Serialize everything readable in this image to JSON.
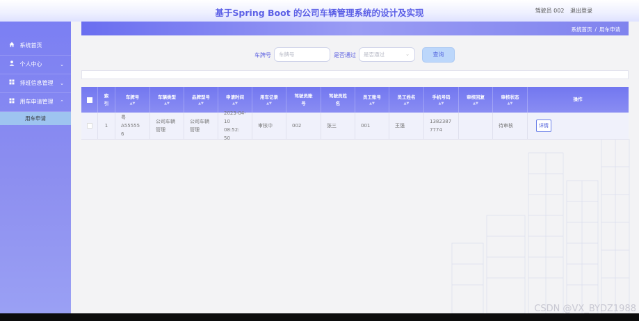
{
  "header": {
    "title": "基于Spring Boot 的公司车辆管理系统的设计及实现",
    "user": "驾驶员 002",
    "logout": "退出登录"
  },
  "sidebar": {
    "items": [
      {
        "label": "系统首页",
        "icon": "home-icon",
        "has_chevron": false
      },
      {
        "label": "个人中心",
        "icon": "user-icon",
        "has_chevron": true
      },
      {
        "label": "排班信息管理",
        "icon": "grid-icon",
        "has_chevron": true
      },
      {
        "label": "用车申请管理",
        "icon": "grid-icon",
        "has_chevron": true,
        "expanded": true
      }
    ],
    "sub_items": [
      {
        "label": "用车申请",
        "active": true
      }
    ]
  },
  "breadcrumb": {
    "home": "系统首页",
    "separator": "/",
    "current": "用车申请"
  },
  "search": {
    "plate_label": "车牌号",
    "plate_placeholder": "车牌号",
    "approved_label": "是否通过",
    "approved_placeholder": "是否通过",
    "query_button": "查询"
  },
  "table": {
    "columns": [
      {
        "key": "check",
        "label": ""
      },
      {
        "key": "index",
        "label": "索引",
        "lines": [
          "索",
          "引"
        ]
      },
      {
        "key": "plate",
        "label": "车牌号"
      },
      {
        "key": "vehicle_type",
        "label": "车辆类型"
      },
      {
        "key": "brand",
        "label": "品牌型号"
      },
      {
        "key": "apply_time",
        "label": "申请时间"
      },
      {
        "key": "usage",
        "label": "用车记录"
      },
      {
        "key": "driver_account",
        "label": "驾驶员账号",
        "lines": [
          "驾驶员账",
          "号"
        ]
      },
      {
        "key": "driver_name",
        "label": "驾驶员姓名",
        "lines": [
          "驾驶员姓",
          "名"
        ]
      },
      {
        "key": "employee_account",
        "label": "员工账号"
      },
      {
        "key": "employee_name",
        "label": "员工姓名"
      },
      {
        "key": "phone",
        "label": "手机号码"
      },
      {
        "key": "review_reply",
        "label": "审核回复"
      },
      {
        "key": "review_status",
        "label": "审核状态"
      },
      {
        "key": "actions",
        "label": "操作"
      }
    ],
    "rows": [
      {
        "index": "1",
        "plate": [
          "粤A55555",
          "6"
        ],
        "vehicle_type": [
          "公司车辆",
          "管理"
        ],
        "brand": [
          "公司车辆",
          "管理"
        ],
        "apply_time": [
          "2023-04-",
          "10 08:52:",
          "50"
        ],
        "usage": "审核中",
        "driver_account": "002",
        "driver_name": "张三",
        "employee_account": "001",
        "employee_name": "王强",
        "phone": [
          "1382387",
          "7774"
        ],
        "review_reply": "",
        "review_status": "待审核",
        "action_label": "详情"
      }
    ]
  },
  "watermark": "CSDN @VX_BYDZ1988",
  "colors": {
    "accent": "#6a6ef0",
    "title": "#5b5fe6",
    "sidebar": "#8d8ff0",
    "sub_active": "#9ec4f0"
  }
}
